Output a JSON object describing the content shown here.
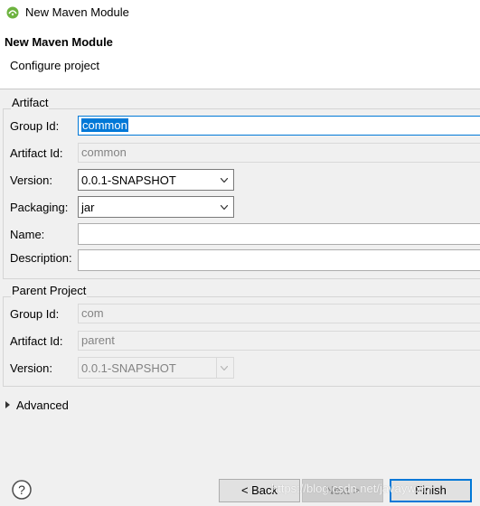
{
  "window": {
    "title": "New Maven Module",
    "icon": "eclipse-icon"
  },
  "header": {
    "title": "New Maven Module",
    "subtitle": "Configure project"
  },
  "artifact": {
    "group_title": "Artifact",
    "group_id_label": "Group Id:",
    "group_id_value": "common",
    "artifact_id_label": "Artifact Id:",
    "artifact_id_value": "common",
    "version_label": "Version:",
    "version_value": "0.0.1-SNAPSHOT",
    "packaging_label": "Packaging:",
    "packaging_value": "jar",
    "name_label": "Name:",
    "name_value": "",
    "description_label": "Description:",
    "description_value": ""
  },
  "parent": {
    "group_title": "Parent Project",
    "group_id_label": "Group Id:",
    "group_id_value": "com",
    "artifact_id_label": "Artifact Id:",
    "artifact_id_value": "parent",
    "version_label": "Version:",
    "version_value": "0.0.1-SNAPSHOT"
  },
  "advanced": {
    "label": "Advanced",
    "icon": "triangle-right-icon"
  },
  "footer": {
    "help_icon": "help-icon",
    "back_label": "< Back",
    "next_label": "Next >",
    "finish_label": "Finish"
  },
  "watermark": "https://blog.csdn.net/javaywxiq",
  "colors": {
    "accent": "#0078d7",
    "background": "#f0f0f0",
    "disabled_text": "#838383"
  }
}
